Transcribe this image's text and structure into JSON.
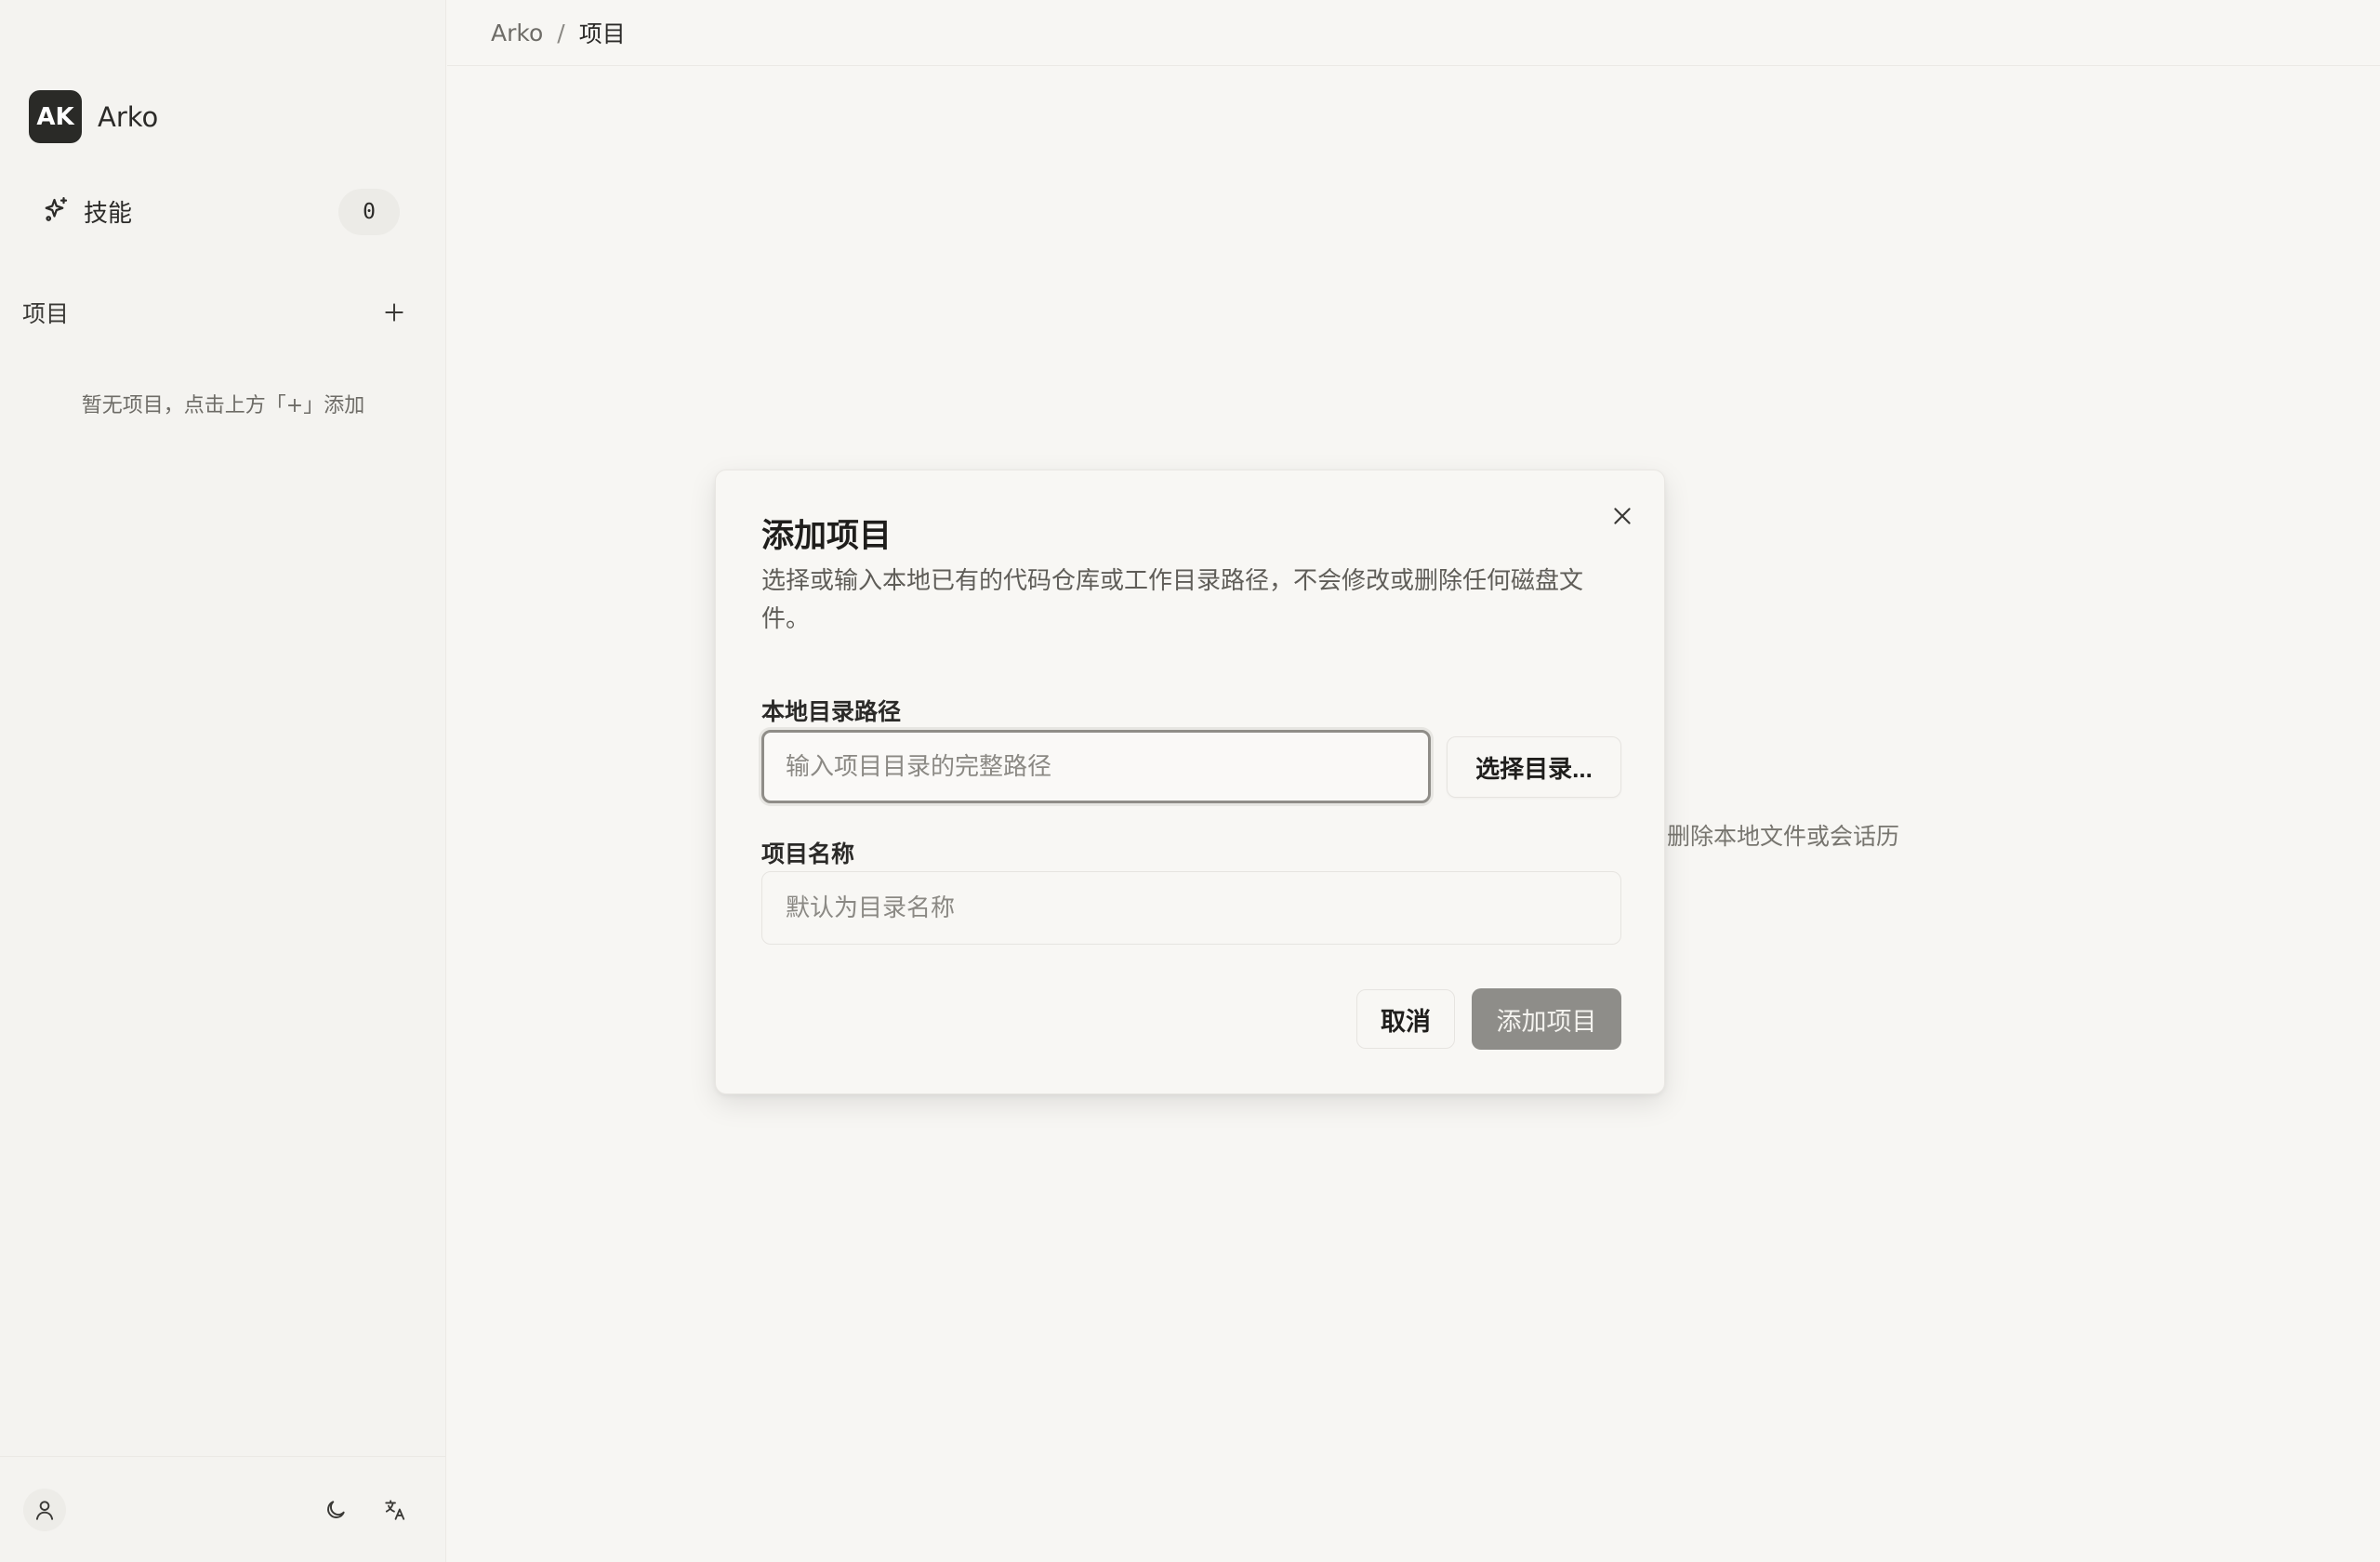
{
  "app": {
    "avatar_initials": "AK",
    "name": "Arko"
  },
  "sidebar": {
    "skills": {
      "label": "技能",
      "count": "0",
      "icon": "sparkle-icon"
    },
    "projects": {
      "title": "项目",
      "add_icon": "plus-icon",
      "empty_hint": "暂无项目，点击上方「+」添加"
    },
    "footer": {
      "user_icon": "user-icon",
      "theme_icon": "moon-icon",
      "language_icon": "translate-icon"
    }
  },
  "breadcrumb": {
    "root": "Arko",
    "separator": "/",
    "current": "项目"
  },
  "background": {
    "partial_text": "删除本地文件或会话历"
  },
  "modal": {
    "title": "添加项目",
    "description": "选择或输入本地已有的代码仓库或工作目录路径，不会修改或删除任何磁盘文件。",
    "path_label": "本地目录路径",
    "path_value": "",
    "path_placeholder": "输入项目目录的完整路径",
    "browse_label": "选择目录...",
    "name_label": "项目名称",
    "name_value": "",
    "name_placeholder": "默认为目录名称",
    "cancel_label": "取消",
    "submit_label": "添加项目",
    "close_icon": "close-icon"
  },
  "colors": {
    "background": "#f7f6f3",
    "sidebar": "#f4f3f0",
    "avatar": "#2a2a27",
    "submit_disabled": "#8e8d89",
    "text_primary": "#2b2a28",
    "text_muted": "#6e6c67"
  }
}
